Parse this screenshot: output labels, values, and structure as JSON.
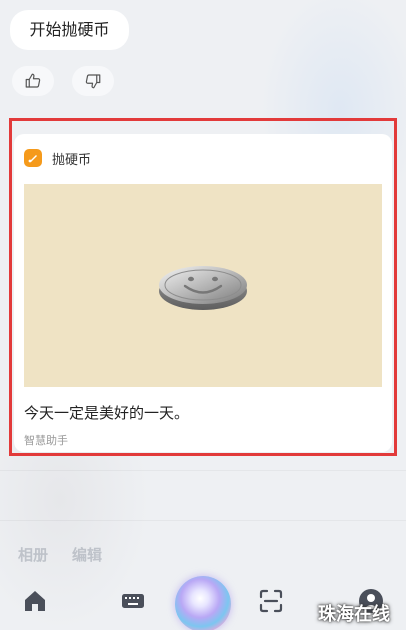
{
  "command": "开始抛硬币",
  "feedback": {
    "like_icon": "thumbs-up-icon",
    "dislike_icon": "thumbs-down-icon"
  },
  "card": {
    "app_icon": "coin-app-icon",
    "title": "抛硬币",
    "image_desc": "coin-smiley-face",
    "message": "今天一定是美好的一天。",
    "footer": "智慧助手"
  },
  "background_tabs": [
    "相册",
    "编辑"
  ],
  "bottom_nav": {
    "home_icon": "home-icon",
    "keyboard_icon": "keyboard-icon",
    "voice_icon": "voice-assistant-orb",
    "scan_icon": "scan-icon",
    "profile_icon": "profile-icon"
  },
  "watermark": "珠海在线",
  "colors": {
    "highlight_border": "#e23a3a",
    "app_icon_bg": "#f59a1b",
    "coin_bg": "#efe3c4"
  }
}
